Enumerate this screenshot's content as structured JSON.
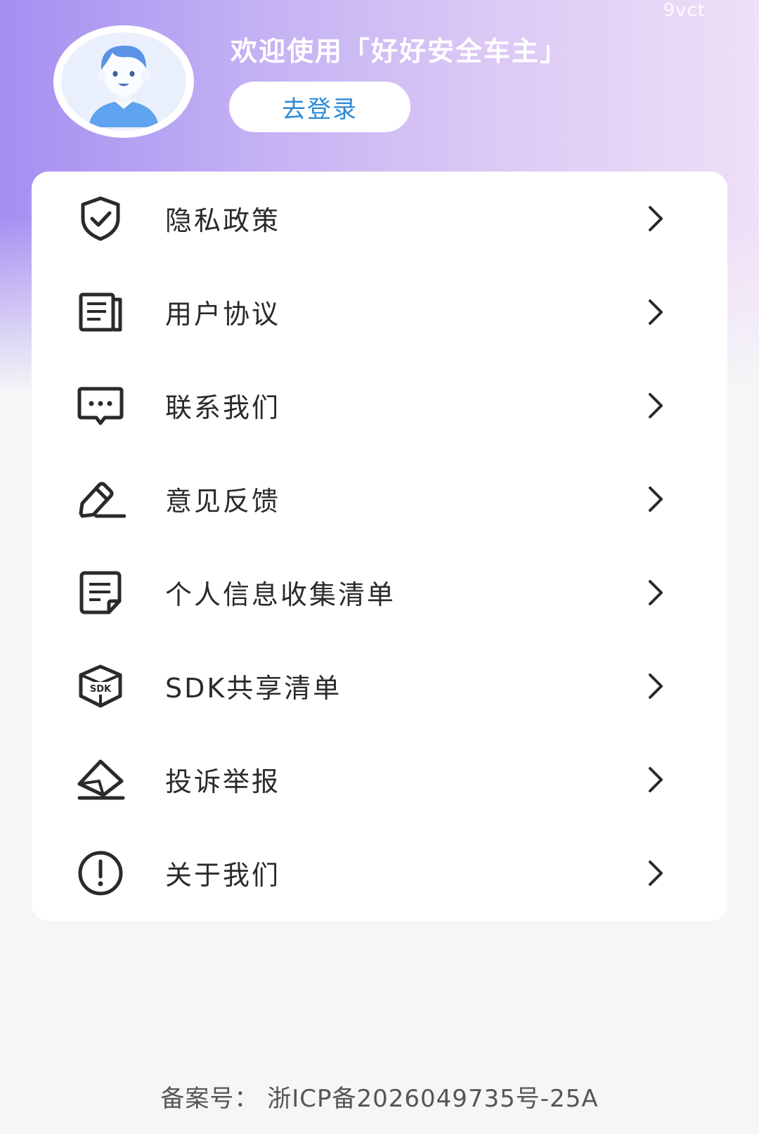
{
  "header": {
    "watermark": "9vct",
    "welcome": "欢迎使用「好好安全车主」",
    "login_button": "去登录"
  },
  "menu": {
    "items": [
      {
        "label": "隐私政策",
        "icon": "shield-check-icon"
      },
      {
        "label": "用户协议",
        "icon": "document-list-icon"
      },
      {
        "label": "联系我们",
        "icon": "chat-bubble-icon"
      },
      {
        "label": "意见反馈",
        "icon": "pencil-icon"
      },
      {
        "label": "个人信息收集清单",
        "icon": "note-icon"
      },
      {
        "label": "SDK共享清单",
        "icon": "sdk-box-icon"
      },
      {
        "label": "投诉举报",
        "icon": "envelope-icon"
      },
      {
        "label": "关于我们",
        "icon": "info-alert-icon"
      }
    ]
  },
  "footer": {
    "icp": "备案号：  浙ICP备2026049735号-25A"
  },
  "colors": {
    "accent": "#2c8ad6",
    "gradient_start": "#a58ff1",
    "gradient_end": "#efdff7",
    "text": "#2a2a2a"
  }
}
